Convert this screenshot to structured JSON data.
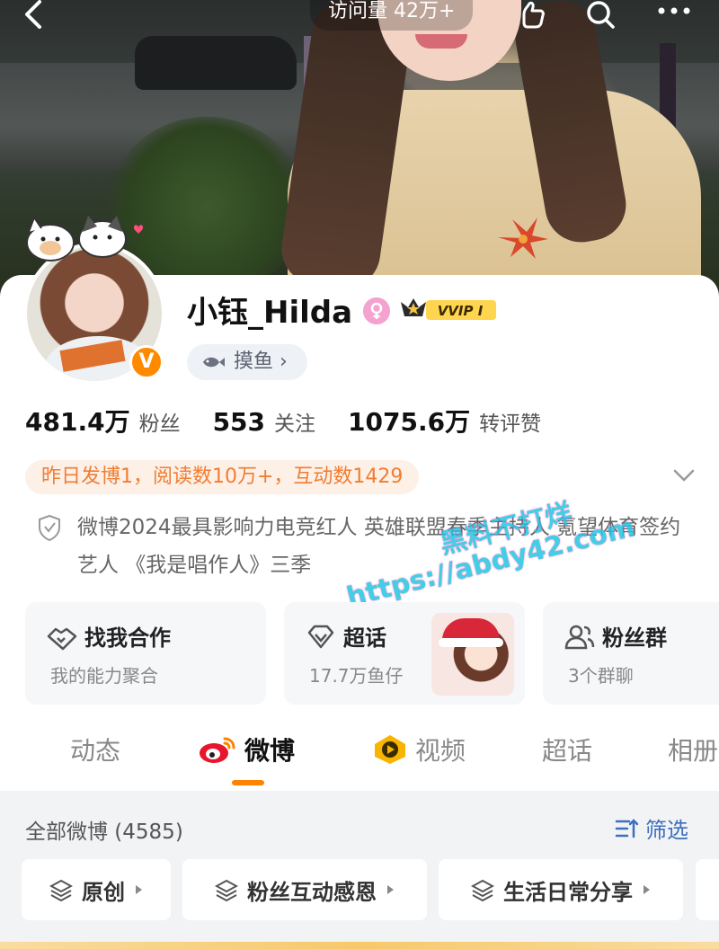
{
  "header": {
    "visits": "访问量 42万+"
  },
  "profile": {
    "name": "小钰_Hilda",
    "vip_label": "VVIP I",
    "verified_mark": "V",
    "tag": "摸鱼 ›",
    "stats": [
      {
        "value": "481.4万",
        "label": "粉丝"
      },
      {
        "value": "553",
        "label": "关注"
      },
      {
        "value": "1075.6万",
        "label": "转评赞"
      }
    ],
    "activity": "昨日发博1，阅读数10万+，互动数1429",
    "bio": "微博2024最具影响力电竞红人 英雄联盟春季主持人 氪望体育签约艺人 《我是唱作人》三季",
    "watermark_line1": "黑料不打烊",
    "watermark_line2": "https://abdy42.com"
  },
  "features": [
    {
      "title": "找我合作",
      "subtitle": "我的能力聚合"
    },
    {
      "title": "超话",
      "subtitle": "17.7万鱼仔"
    },
    {
      "title": "粉丝群",
      "subtitle": "3个群聊"
    }
  ],
  "tabs": [
    "动态",
    "微博",
    "视频",
    "超话",
    "相册"
  ],
  "posts": {
    "all_label": "全部微博 (4585)",
    "filter_label": "筛选",
    "chips": [
      "原创",
      "粉丝互动感恩",
      "生活日常分享"
    ]
  },
  "colors": {
    "accent": "#ff8200",
    "activity_text": "#f07d34",
    "link": "#3d6fbf"
  }
}
